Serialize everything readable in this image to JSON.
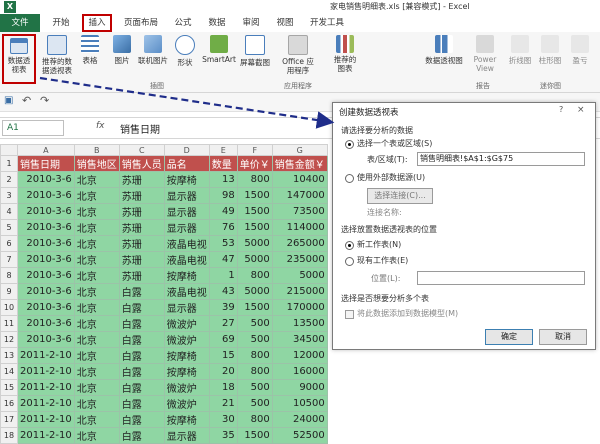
{
  "app": {
    "title": "家电销售明细表.xls [兼容模式] - Excel",
    "logo_letter": "X",
    "brand_color": "#217346"
  },
  "ribbon_tabs": [
    "文件",
    "开始",
    "插入",
    "页面布局",
    "公式",
    "数据",
    "审阅",
    "视图",
    "开发工具"
  ],
  "ribbon": {
    "pivot": "数据透视表",
    "recommended_pivot": "推荐的数据透视表",
    "table": "表格",
    "picture": "图片",
    "online_picture": "联机图片",
    "shapes": "形状",
    "smartart": "SmartArt",
    "screenshot": "屏幕截图",
    "office_apps": "Office 应用程序",
    "recommended_charts": "推荐的图表",
    "pivot_chart": "数据透视图",
    "power_view": "Power View",
    "line": "折线图",
    "column": "柱形图",
    "winloss": "盈亏",
    "group_illustrations": "插图",
    "group_apps": "应用程序",
    "group_reports": "报告",
    "group_sparklines": "迷你图"
  },
  "formula_bar": {
    "name_box": "A1",
    "fx": "fx",
    "value": "销售日期"
  },
  "sheet": {
    "columns": [
      "A",
      "B",
      "C",
      "D",
      "E",
      "F",
      "G"
    ],
    "row_numbers": [
      "1",
      "2",
      "3",
      "4",
      "5",
      "6",
      "7",
      "8",
      "9",
      "10",
      "11",
      "12",
      "13",
      "14",
      "15",
      "16",
      "17",
      "18"
    ],
    "header": [
      "销售日期",
      "销售地区",
      "销售人员",
      "品名",
      "数量",
      "单价￥",
      "销售金额￥"
    ],
    "rows": [
      [
        "2010-3-6",
        "北京",
        "苏珊",
        "按摩椅",
        "13",
        "800",
        "10400"
      ],
      [
        "2010-3-6",
        "北京",
        "苏珊",
        "显示器",
        "98",
        "1500",
        "147000"
      ],
      [
        "2010-3-6",
        "北京",
        "苏珊",
        "显示器",
        "49",
        "1500",
        "73500"
      ],
      [
        "2010-3-6",
        "北京",
        "苏珊",
        "显示器",
        "76",
        "1500",
        "114000"
      ],
      [
        "2010-3-6",
        "北京",
        "苏珊",
        "液晶电视",
        "53",
        "5000",
        "265000"
      ],
      [
        "2010-3-6",
        "北京",
        "苏珊",
        "液晶电视",
        "47",
        "5000",
        "235000"
      ],
      [
        "2010-3-6",
        "北京",
        "苏珊",
        "按摩椅",
        "1",
        "800",
        "5000"
      ],
      [
        "2010-3-6",
        "北京",
        "白露",
        "液晶电视",
        "43",
        "5000",
        "215000"
      ],
      [
        "2010-3-6",
        "北京",
        "白露",
        "显示器",
        "39",
        "1500",
        "170000"
      ],
      [
        "2010-3-6",
        "北京",
        "白露",
        "微波炉",
        "27",
        "500",
        "13500"
      ],
      [
        "2010-3-6",
        "北京",
        "白露",
        "微波炉",
        "69",
        "500",
        "34500"
      ],
      [
        "2011-2-10",
        "北京",
        "白露",
        "按摩椅",
        "15",
        "800",
        "12000"
      ],
      [
        "2011-2-10",
        "北京",
        "白露",
        "按摩椅",
        "20",
        "800",
        "16000"
      ],
      [
        "2011-2-10",
        "北京",
        "白露",
        "微波炉",
        "18",
        "500",
        "9000"
      ],
      [
        "2011-2-10",
        "北京",
        "白露",
        "微波炉",
        "21",
        "500",
        "10500"
      ],
      [
        "2011-2-10",
        "北京",
        "白露",
        "按摩椅",
        "30",
        "800",
        "24000"
      ],
      [
        "2011-2-10",
        "北京",
        "白露",
        "显示器",
        "35",
        "1500",
        "52500"
      ]
    ],
    "header_color": "#c0504d",
    "cell_color": "#8fd6a3"
  },
  "dialog": {
    "title": "创建数据透视表",
    "help": "?",
    "close": "×",
    "section1": "请选择要分析的数据",
    "opt_select_range": "选择一个表或区域(S)",
    "table_range_label": "表/区域(T):",
    "table_range_value": "销售明细表!$A$1:$G$75",
    "opt_external": "使用外部数据源(U)",
    "choose_connection": "选择连接(C)...",
    "connection_name": "连接名称:",
    "section2": "选择放置数据透视表的位置",
    "opt_new_sheet": "新工作表(N)",
    "opt_existing_sheet": "现有工作表(E)",
    "location_label": "位置(L):",
    "section3": "选择是否想要分析多个表",
    "add_to_model": "将此数据添加到数据模型(M)",
    "ok": "确定",
    "cancel": "取消"
  }
}
